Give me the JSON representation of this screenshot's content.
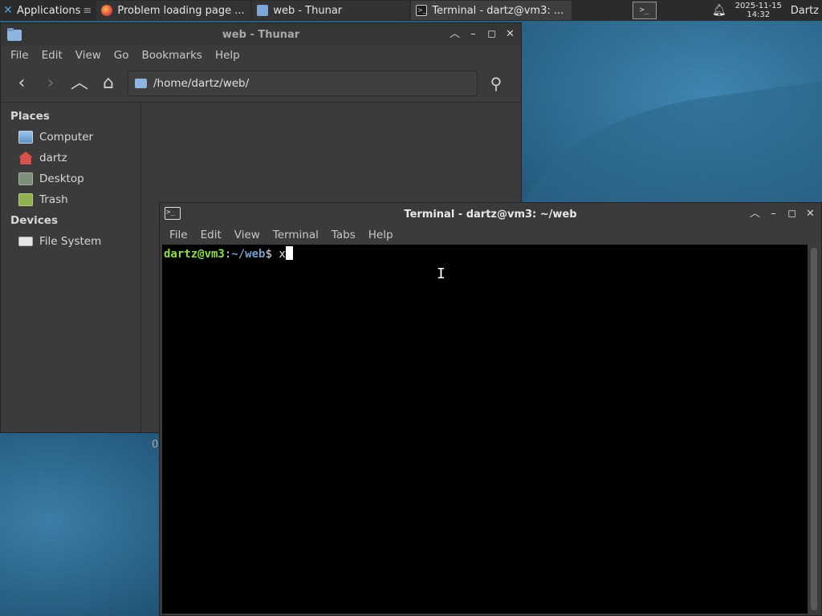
{
  "panel": {
    "applications_label": "Applications",
    "tasks": [
      {
        "label": "Problem loading page ...",
        "icon": "firefox-icon"
      },
      {
        "label": "web - Thunar",
        "icon": "folder-icon"
      },
      {
        "label": "Terminal - dartz@vm3: ...",
        "icon": "terminal-icon"
      }
    ],
    "clock_date": "2025-11-15",
    "clock_time": "14:32",
    "user": "Dartz"
  },
  "thunar": {
    "title": "web - Thunar",
    "menu": [
      "File",
      "Edit",
      "View",
      "Go",
      "Bookmarks",
      "Help"
    ],
    "location": "/home/dartz/web/",
    "sidebar": {
      "places_heading": "Places",
      "places": [
        "Computer",
        "dartz",
        "Desktop",
        "Trash"
      ],
      "devices_heading": "Devices",
      "devices": [
        "File System"
      ]
    },
    "status_text": "0"
  },
  "terminal": {
    "title": "Terminal - dartz@vm3: ~/web",
    "menu": [
      "File",
      "Edit",
      "View",
      "Terminal",
      "Tabs",
      "Help"
    ],
    "prompt_user": "dartz@vm3",
    "prompt_colon": ":",
    "prompt_path": "~/web",
    "prompt_dollar": "$",
    "typed": " x"
  },
  "colors": {
    "prompt_user": "#8ae234",
    "prompt_path": "#729fcf",
    "panel_bg": "#2b2b2b",
    "window_bg": "#3b3b3b"
  }
}
